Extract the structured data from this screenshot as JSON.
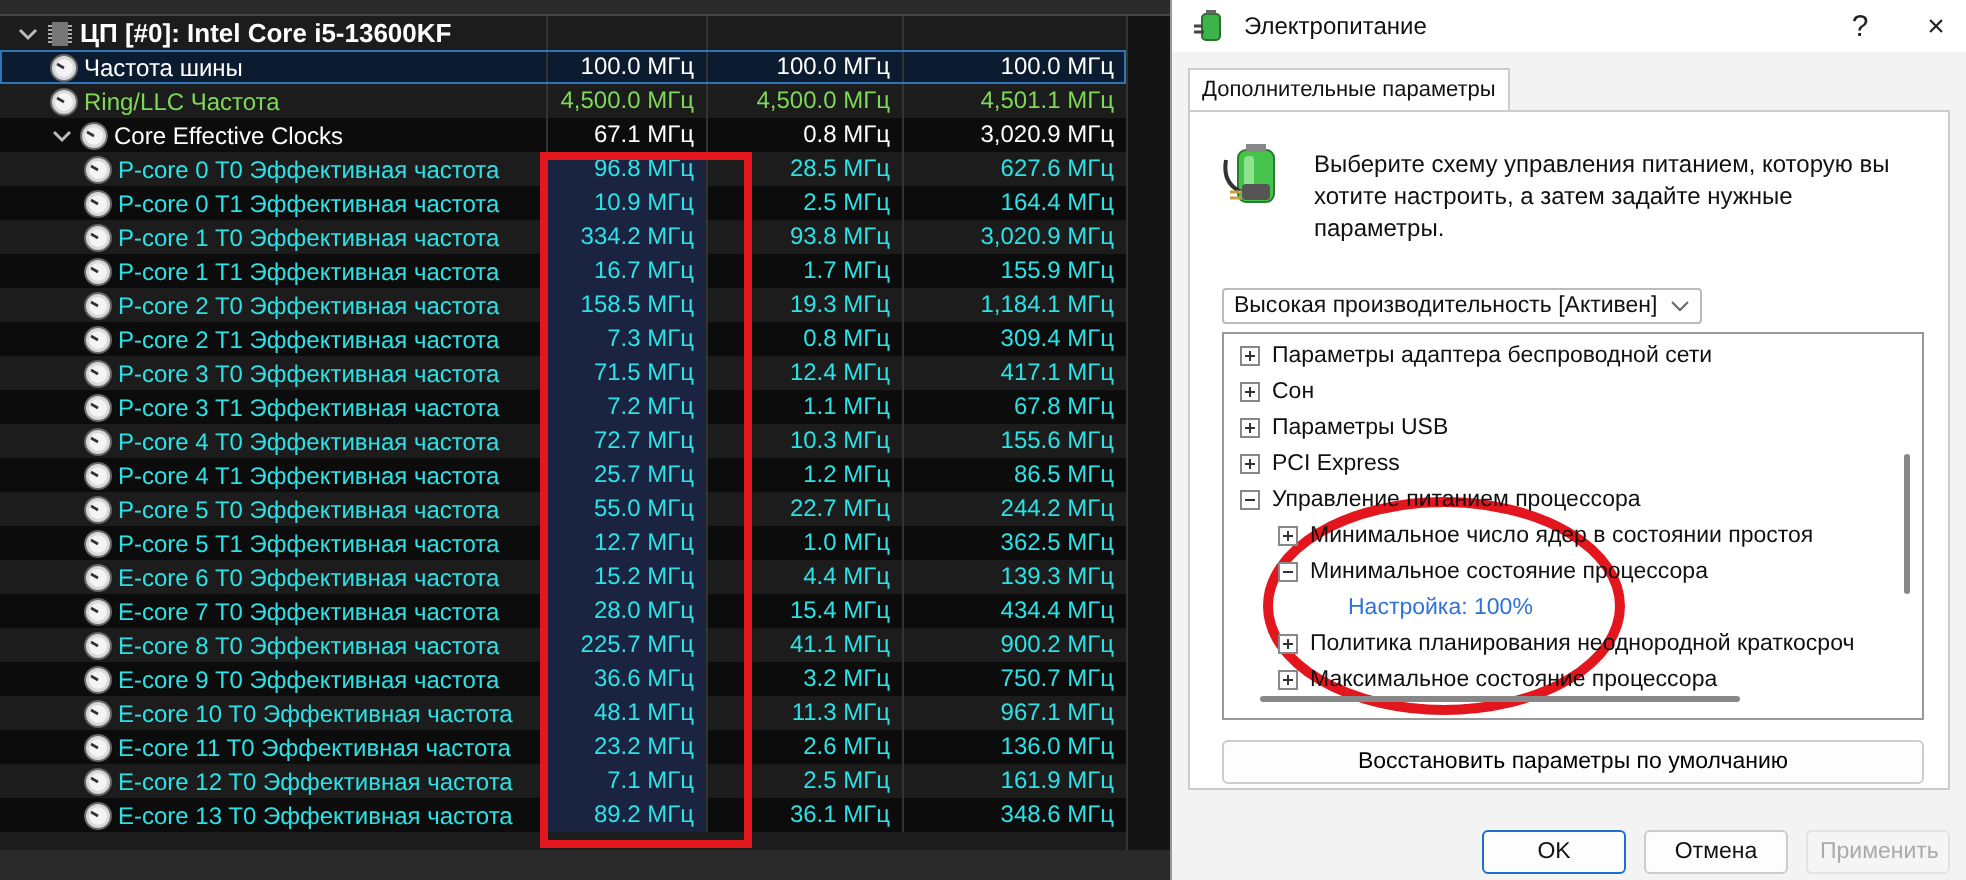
{
  "sensors": {
    "rows": [
      {
        "kind": "group",
        "label": "ЦП [#0]: Intel Core i5-13600KF",
        "expanded": true,
        "selected": false,
        "children": [
          {
            "kind": "sensor",
            "label": "Частота шины",
            "current": "100.0 МГц",
            "min": "100.0 МГц",
            "max": "100.0 МГц",
            "selected": true
          },
          {
            "kind": "sensor",
            "label": "Ring/LLC Частота",
            "color": "#7ed957",
            "current": "4,500.0 МГц",
            "min": "4,500.0 МГц",
            "max": "4,501.1 МГц",
            "selected": false
          },
          {
            "kind": "group",
            "label": "Core Effective Clocks",
            "current": "67.1 МГц",
            "min": "0.8 МГц",
            "max": "3,020.9 МГц",
            "expanded": true,
            "selected": false,
            "children": [
              {
                "kind": "sensor",
                "label": "P-core 0 T0 Эффективная частота",
                "color": "#2de2e6",
                "current": "96.8 МГц",
                "min": "28.5 МГц",
                "max": "627.6 МГц",
                "selected": false
              },
              {
                "kind": "sensor",
                "label": "P-core 0 T1 Эффективная частота",
                "color": "#2de2e6",
                "current": "10.9 МГц",
                "min": "2.5 МГц",
                "max": "164.4 МГц",
                "selected": false
              },
              {
                "kind": "sensor",
                "label": "P-core 1 T0 Эффективная частота",
                "color": "#2de2e6",
                "current": "334.2 МГц",
                "min": "93.8 МГц",
                "max": "3,020.9 МГц",
                "selected": false
              },
              {
                "kind": "sensor",
                "label": "P-core 1 T1 Эффективная частота",
                "color": "#2de2e6",
                "current": "16.7 МГц",
                "min": "1.7 МГц",
                "max": "155.9 МГц",
                "selected": false
              },
              {
                "kind": "sensor",
                "label": "P-core 2 T0 Эффективная частота",
                "color": "#2de2e6",
                "current": "158.5 МГц",
                "min": "19.3 МГц",
                "max": "1,184.1 МГц",
                "selected": false
              },
              {
                "kind": "sensor",
                "label": "P-core 2 T1 Эффективная частота",
                "color": "#2de2e6",
                "current": "7.3 МГц",
                "min": "0.8 МГц",
                "max": "309.4 МГц",
                "selected": false
              },
              {
                "kind": "sensor",
                "label": "P-core 3 T0 Эффективная частота",
                "color": "#2de2e6",
                "current": "71.5 МГц",
                "min": "12.4 МГц",
                "max": "417.1 МГц",
                "selected": false
              },
              {
                "kind": "sensor",
                "label": "P-core 3 T1 Эффективная частота",
                "color": "#2de2e6",
                "current": "7.2 МГц",
                "min": "1.1 МГц",
                "max": "67.8 МГц",
                "selected": false
              },
              {
                "kind": "sensor",
                "label": "P-core 4 T0 Эффективная частота",
                "color": "#2de2e6",
                "current": "72.7 МГц",
                "min": "10.3 МГц",
                "max": "155.6 МГц",
                "selected": false
              },
              {
                "kind": "sensor",
                "label": "P-core 4 T1 Эффективная частота",
                "color": "#2de2e6",
                "current": "25.7 МГц",
                "min": "1.2 МГц",
                "max": "86.5 МГц",
                "selected": false
              },
              {
                "kind": "sensor",
                "label": "P-core 5 T0 Эффективная частота",
                "color": "#2de2e6",
                "current": "55.0 МГц",
                "min": "22.7 МГц",
                "max": "244.2 МГц",
                "selected": false
              },
              {
                "kind": "sensor",
                "label": "P-core 5 T1 Эффективная частота",
                "color": "#2de2e6",
                "current": "12.7 МГц",
                "min": "1.0 МГц",
                "max": "362.5 МГц",
                "selected": false
              },
              {
                "kind": "sensor",
                "label": "E-core 6 T0 Эффективная частота",
                "color": "#2de2e6",
                "current": "15.2 МГц",
                "min": "4.4 МГц",
                "max": "139.3 МГц",
                "selected": false
              },
              {
                "kind": "sensor",
                "label": "E-core 7 T0 Эффективная частота",
                "color": "#2de2e6",
                "current": "28.0 МГц",
                "min": "15.4 МГц",
                "max": "434.4 МГц",
                "selected": false
              },
              {
                "kind": "sensor",
                "label": "E-core 8 T0 Эффективная частота",
                "color": "#2de2e6",
                "current": "225.7 МГц",
                "min": "41.1 МГц",
                "max": "900.2 МГц",
                "selected": false
              },
              {
                "kind": "sensor",
                "label": "E-core 9 T0 Эффективная частота",
                "color": "#2de2e6",
                "current": "36.6 МГц",
                "min": "3.2 МГц",
                "max": "750.7 МГц",
                "selected": false
              },
              {
                "kind": "sensor",
                "label": "E-core 10 T0 Эффективная частота",
                "color": "#2de2e6",
                "current": "48.1 МГц",
                "min": "11.3 МГц",
                "max": "967.1 МГц",
                "selected": false
              },
              {
                "kind": "sensor",
                "label": "E-core 11 T0 Эффективная частота",
                "color": "#2de2e6",
                "current": "23.2 МГц",
                "min": "2.6 МГц",
                "max": "136.0 МГц",
                "selected": false
              },
              {
                "kind": "sensor",
                "label": "E-core 12 T0 Эффективная частота",
                "color": "#2de2e6",
                "current": "7.1 МГц",
                "min": "2.5 МГц",
                "max": "161.9 МГц",
                "selected": false
              },
              {
                "kind": "sensor",
                "label": "E-core 13 T0 Эффективная частота",
                "color": "#2de2e6",
                "current": "89.2 МГц",
                "min": "36.1 МГц",
                "max": "348.6 МГц",
                "selected": false
              }
            ]
          }
        ]
      }
    ]
  },
  "dialog": {
    "title": "Электропитание",
    "help": "?",
    "close": "×",
    "tabs": [
      {
        "label": "Дополнительные параметры",
        "selected": true
      }
    ],
    "description": "Выберите схему управления питанием, которую вы хотите настроить, а затем задайте нужные параметры.",
    "plan": {
      "value": "Высокая производительность [Активен]"
    },
    "settings": [
      {
        "kind": "node",
        "label": "Параметры адаптера беспроводной сети",
        "expanded": false
      },
      {
        "kind": "node",
        "label": "Сон",
        "expanded": false
      },
      {
        "kind": "node",
        "label": "Параметры USB",
        "expanded": false
      },
      {
        "kind": "node",
        "label": "PCI Express",
        "expanded": false
      },
      {
        "kind": "node",
        "label": "Управление питанием процессора",
        "expanded": true,
        "children": [
          {
            "kind": "node",
            "label": "Минимальное число ядер в состоянии простоя",
            "expanded": false
          },
          {
            "kind": "node",
            "label": "Минимальное состояние процессора",
            "expanded": true,
            "children": [
              {
                "kind": "value",
                "label": "Настройка: 100%"
              }
            ]
          },
          {
            "kind": "node",
            "label": "Политика планирования неоднородной краткосроч",
            "expanded": false
          },
          {
            "kind": "node",
            "label": "Максимальное состояние процессора",
            "expanded": false
          }
        ]
      }
    ],
    "restore_button": "Восстановить параметры по умолчанию",
    "buttons": [
      {
        "label": "OK",
        "kind": "default",
        "disabled": false
      },
      {
        "label": "Отмена",
        "kind": "normal",
        "disabled": false
      },
      {
        "label": "Применить",
        "kind": "normal",
        "disabled": true
      }
    ]
  }
}
